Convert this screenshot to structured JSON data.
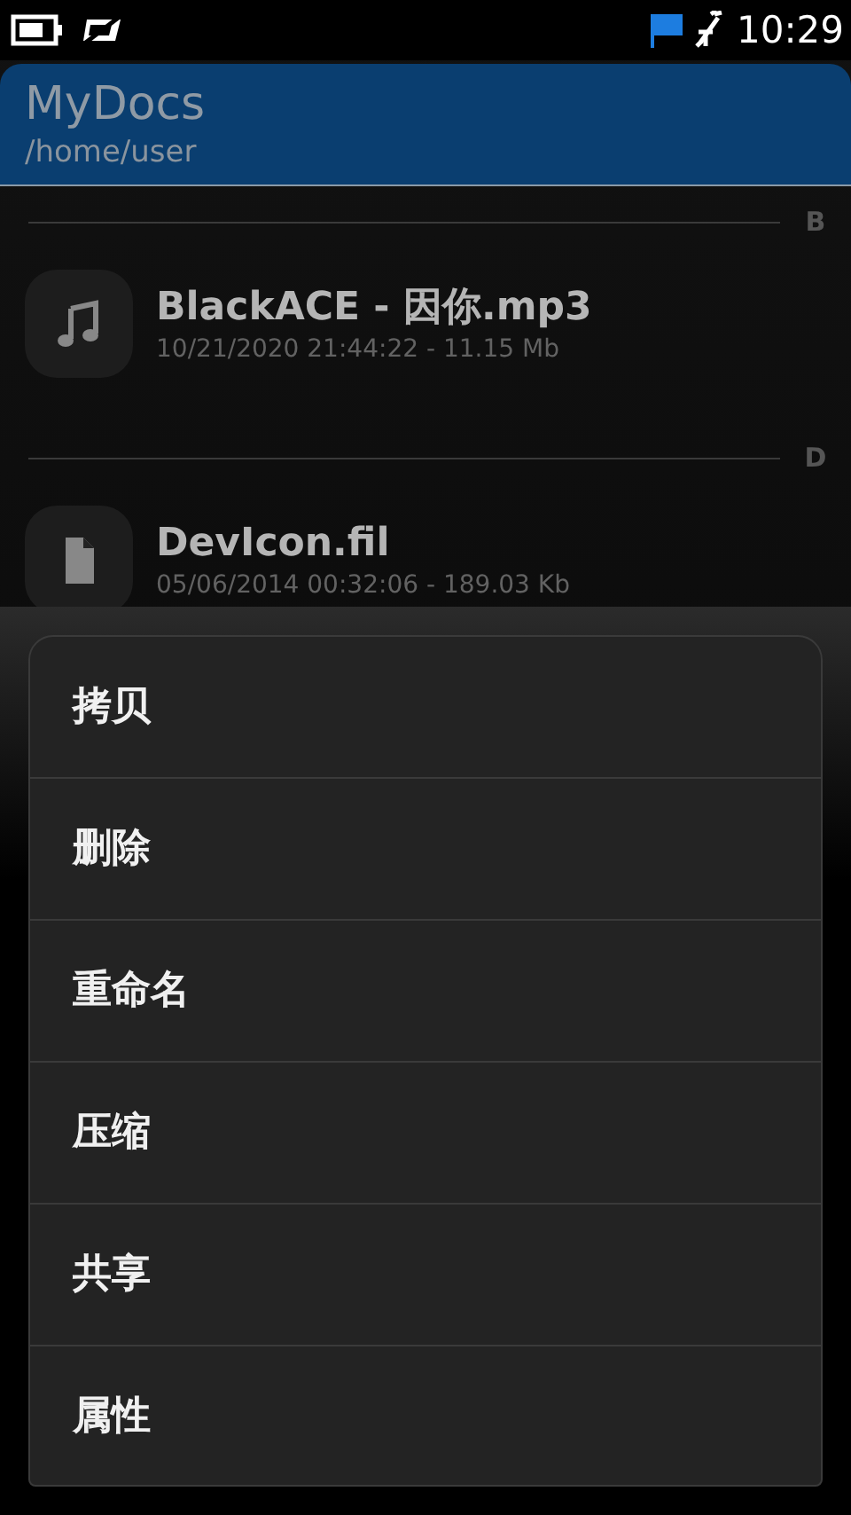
{
  "status_bar": {
    "time": "10:29"
  },
  "header": {
    "title": "MyDocs",
    "path": "/home/user"
  },
  "sections": [
    {
      "letter": "B",
      "items": [
        {
          "kind": "music",
          "name": "BlackACE - 因你.mp3",
          "details": "10/21/2020 21:44:22 - 11.15 Mb"
        }
      ]
    },
    {
      "letter": "D",
      "items": [
        {
          "kind": "file",
          "name": "DevIcon.fil",
          "details": "05/06/2014 00:32:06 - 189.03 Kb"
        }
      ]
    }
  ],
  "menu": [
    "拷贝",
    "删除",
    "重命名",
    "压缩",
    "共享",
    "属性"
  ]
}
